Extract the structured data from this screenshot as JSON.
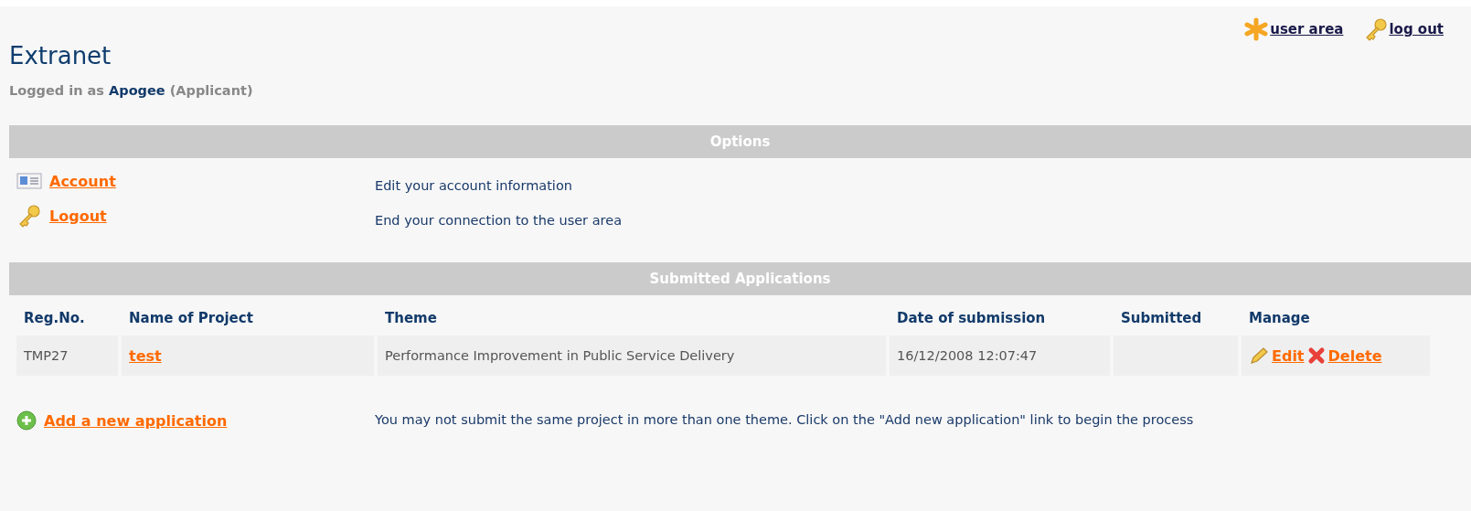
{
  "top_links": [
    {
      "kind": "user_area",
      "label": "user area"
    },
    {
      "kind": "logout",
      "label": "log out"
    }
  ],
  "title": "Extranet",
  "logged_in": {
    "prefix": "Logged in as",
    "user": "Apogee",
    "role": "(Applicant)"
  },
  "options": {
    "heading": "Options",
    "items": [
      {
        "kind": "account",
        "label": "Account",
        "description": "Edit your account information"
      },
      {
        "kind": "logout",
        "label": "Logout",
        "description": "End your connection to the user area"
      }
    ]
  },
  "applications": {
    "heading": "Submitted Applications",
    "columns": [
      "Reg.No.",
      "Name of Project",
      "Theme",
      "Date of submission",
      "Submitted",
      "Manage"
    ],
    "rows": [
      {
        "reg_no": "TMP27",
        "name": "test",
        "theme": "Performance Improvement in Public Service Delivery",
        "date": "16/12/2008 12:07:47",
        "actions": [
          {
            "kind": "edit",
            "label": "Edit"
          },
          {
            "kind": "delete",
            "label": "Delete"
          }
        ]
      }
    ]
  },
  "add": {
    "label": "Add a new application",
    "note": "You may not submit the same project in more than one theme. Click on the \"Add new application\" link to begin the process"
  }
}
